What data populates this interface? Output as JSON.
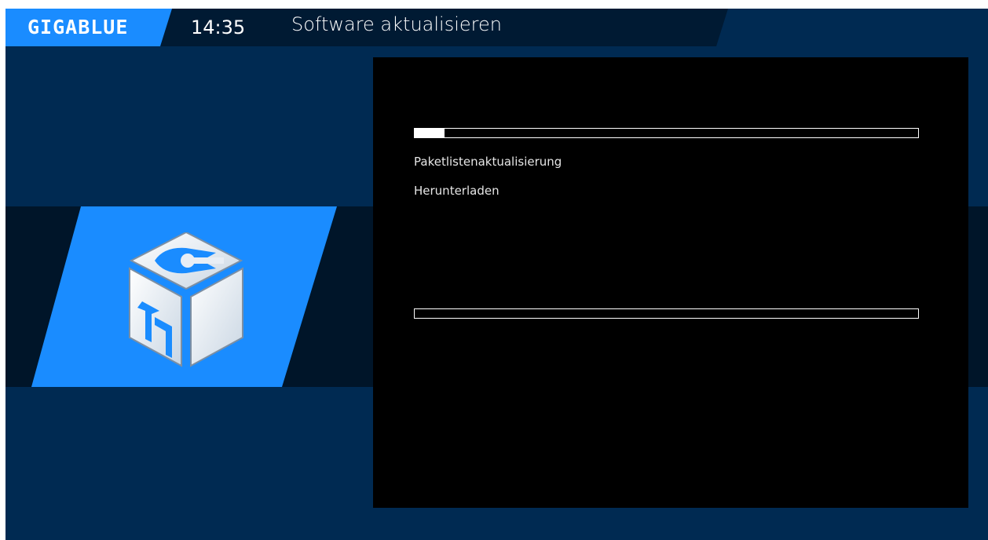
{
  "header": {
    "brand": "GIGABLUE",
    "time": "14:35",
    "title": "Software aktualisieren"
  },
  "dialog": {
    "status_line_1": "Paketlistenaktualisierung",
    "status_line_2": "Herunterladen",
    "progress_top": 0.06,
    "progress_bottom": 0
  },
  "colors": {
    "background": "#002a52",
    "header": "#001a33",
    "accent": "#1a8cff",
    "dialog": "#000000"
  },
  "icons": {
    "logo": "gigablue-logo",
    "update": "software-update-cube-icon"
  }
}
